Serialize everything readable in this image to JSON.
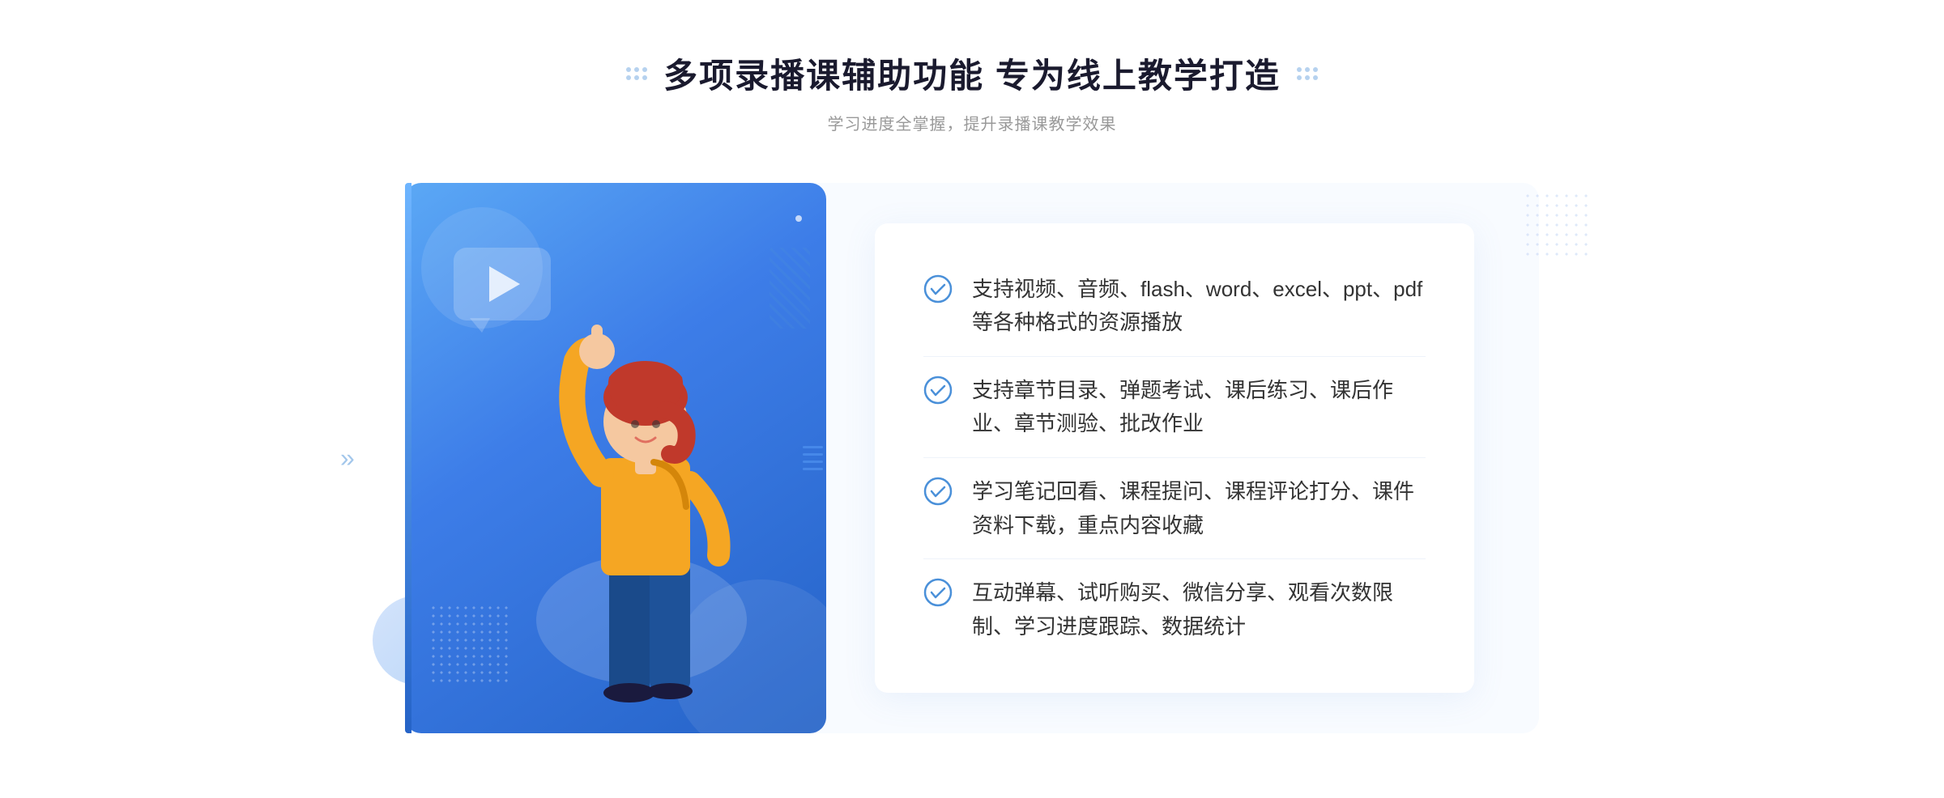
{
  "header": {
    "title": "多项录播课辅助功能 专为线上教学打造",
    "subtitle": "学习进度全掌握，提升录播课教学效果",
    "title_dots_left": ":::::",
    "title_dots_right": ":::::"
  },
  "features": [
    {
      "id": 1,
      "text": "支持视频、音频、flash、word、excel、ppt、pdf等各种格式的资源播放"
    },
    {
      "id": 2,
      "text": "支持章节目录、弹题考试、课后练习、课后作业、章节测验、批改作业"
    },
    {
      "id": 3,
      "text": "学习笔记回看、课程提问、课程评论打分、课件资料下载，重点内容收藏"
    },
    {
      "id": 4,
      "text": "互动弹幕、试听购买、微信分享、观看次数限制、学习进度跟踪、数据统计"
    }
  ],
  "colors": {
    "primary_blue": "#3d7de8",
    "light_blue": "#5ba8f5",
    "dark_blue": "#2563c7",
    "text_dark": "#1a1a2e",
    "text_gray": "#999999",
    "text_body": "#333333",
    "bg_light": "#f8fbff",
    "check_color": "#4a90d9"
  }
}
